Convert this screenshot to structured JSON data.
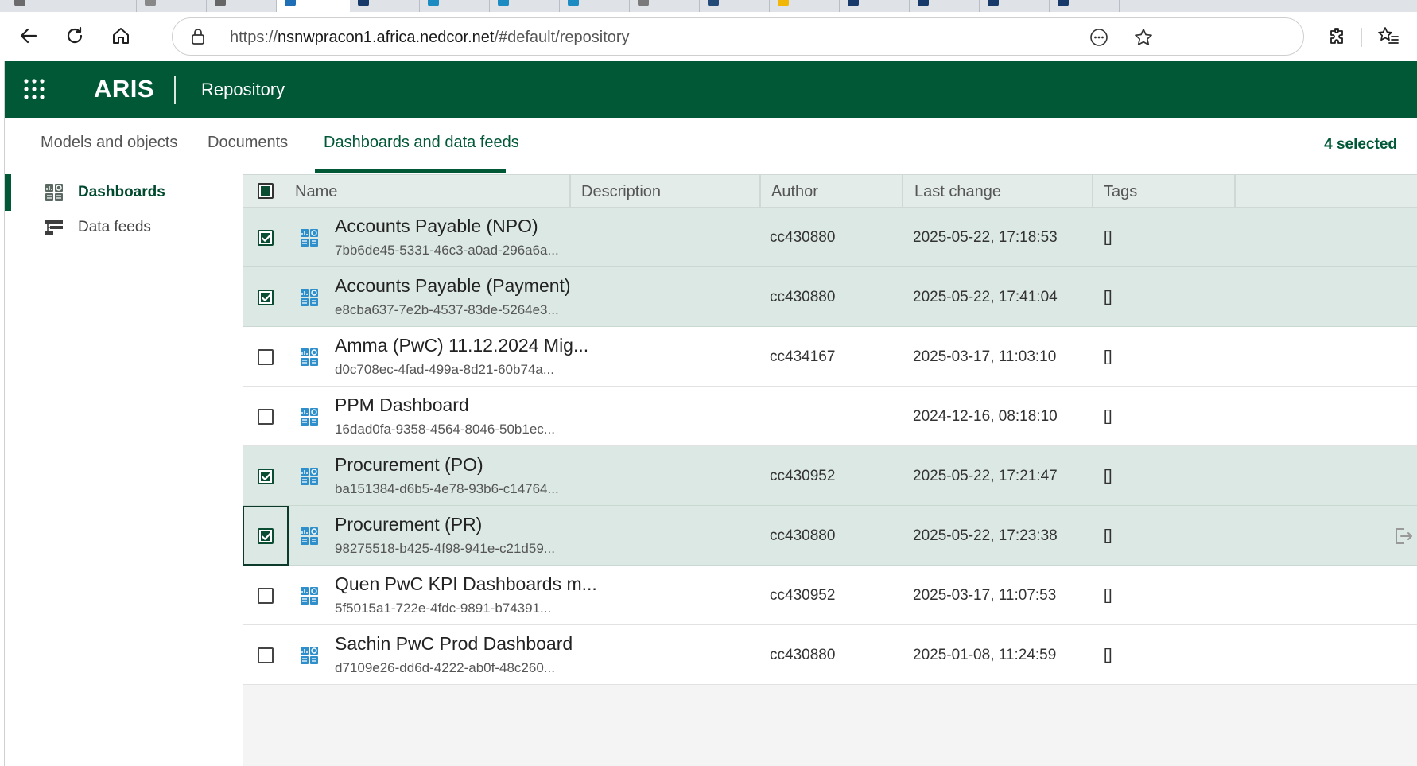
{
  "browser": {
    "url_prefix": "https://",
    "url_host": "nsnwpracon1.africa.nedcor.net",
    "url_path": "/#default/repository",
    "icons": [
      "back-icon",
      "refresh-icon",
      "home-icon",
      "lock-icon",
      "more-icon",
      "favorite-star-icon",
      "extensions-icon",
      "favorites-list-icon"
    ]
  },
  "appbar": {
    "brand": "ARIS",
    "section": "Repository",
    "color": "#005837"
  },
  "tabs": [
    {
      "label": "Models and objects",
      "active": false
    },
    {
      "label": "Documents",
      "active": false
    },
    {
      "label": "Dashboards and data feeds",
      "active": true
    }
  ],
  "selection": {
    "label": "4 selected"
  },
  "sidebar": {
    "items": [
      {
        "label": "Dashboards",
        "icon": "dashboard-icon",
        "active": true
      },
      {
        "label": "Data feeds",
        "icon": "data-feed-icon",
        "active": false
      }
    ]
  },
  "table": {
    "columns": [
      "Name",
      "Description",
      "Author",
      "Last change",
      "Tags"
    ],
    "rows": [
      {
        "name": "Accounts Payable (NPO)",
        "id": "7bb6de45-5331-46c3-a0ad-296a6a...",
        "author": "cc430880",
        "last_change": "2025-05-22, 17:18:53",
        "tags": "[]",
        "checked": true
      },
      {
        "name": "Accounts Payable (Payment)",
        "id": "e8cba637-7e2b-4537-83de-5264e3...",
        "author": "cc430880",
        "last_change": "2025-05-22, 17:41:04",
        "tags": "[]",
        "checked": true
      },
      {
        "name": "Amma (PwC) 11.12.2024 Mig...",
        "id": "d0c708ec-4fad-499a-8d21-60b74a...",
        "author": "cc434167",
        "last_change": "2025-03-17, 11:03:10",
        "tags": "[]",
        "checked": false
      },
      {
        "name": "PPM Dashboard",
        "id": "16dad0fa-9358-4564-8046-50b1ec...",
        "author": "",
        "last_change": "2024-12-16, 08:18:10",
        "tags": "[]",
        "checked": false
      },
      {
        "name": "Procurement (PO)",
        "id": "ba151384-d6b5-4e78-93b6-c14764...",
        "author": "cc430952",
        "last_change": "2025-05-22, 17:21:47",
        "tags": "[]",
        "checked": true
      },
      {
        "name": "Procurement (PR)",
        "id": "98275518-b425-4f98-941e-c21d59...",
        "author": "cc430880",
        "last_change": "2025-05-22, 17:23:38",
        "tags": "[]",
        "checked": true
      },
      {
        "name": "Quen PwC KPI Dashboards m...",
        "id": "5f5015a1-722e-4fdc-9891-b74391...",
        "author": "cc430952",
        "last_change": "2025-03-17, 11:07:53",
        "tags": "[]",
        "checked": false
      },
      {
        "name": "Sachin PwC Prod Dashboard",
        "id": "d7109e26-dd6d-4222-ab0f-48c260...",
        "author": "cc430880",
        "last_change": "2025-01-08, 11:24:59",
        "tags": "[]",
        "checked": false
      }
    ]
  }
}
